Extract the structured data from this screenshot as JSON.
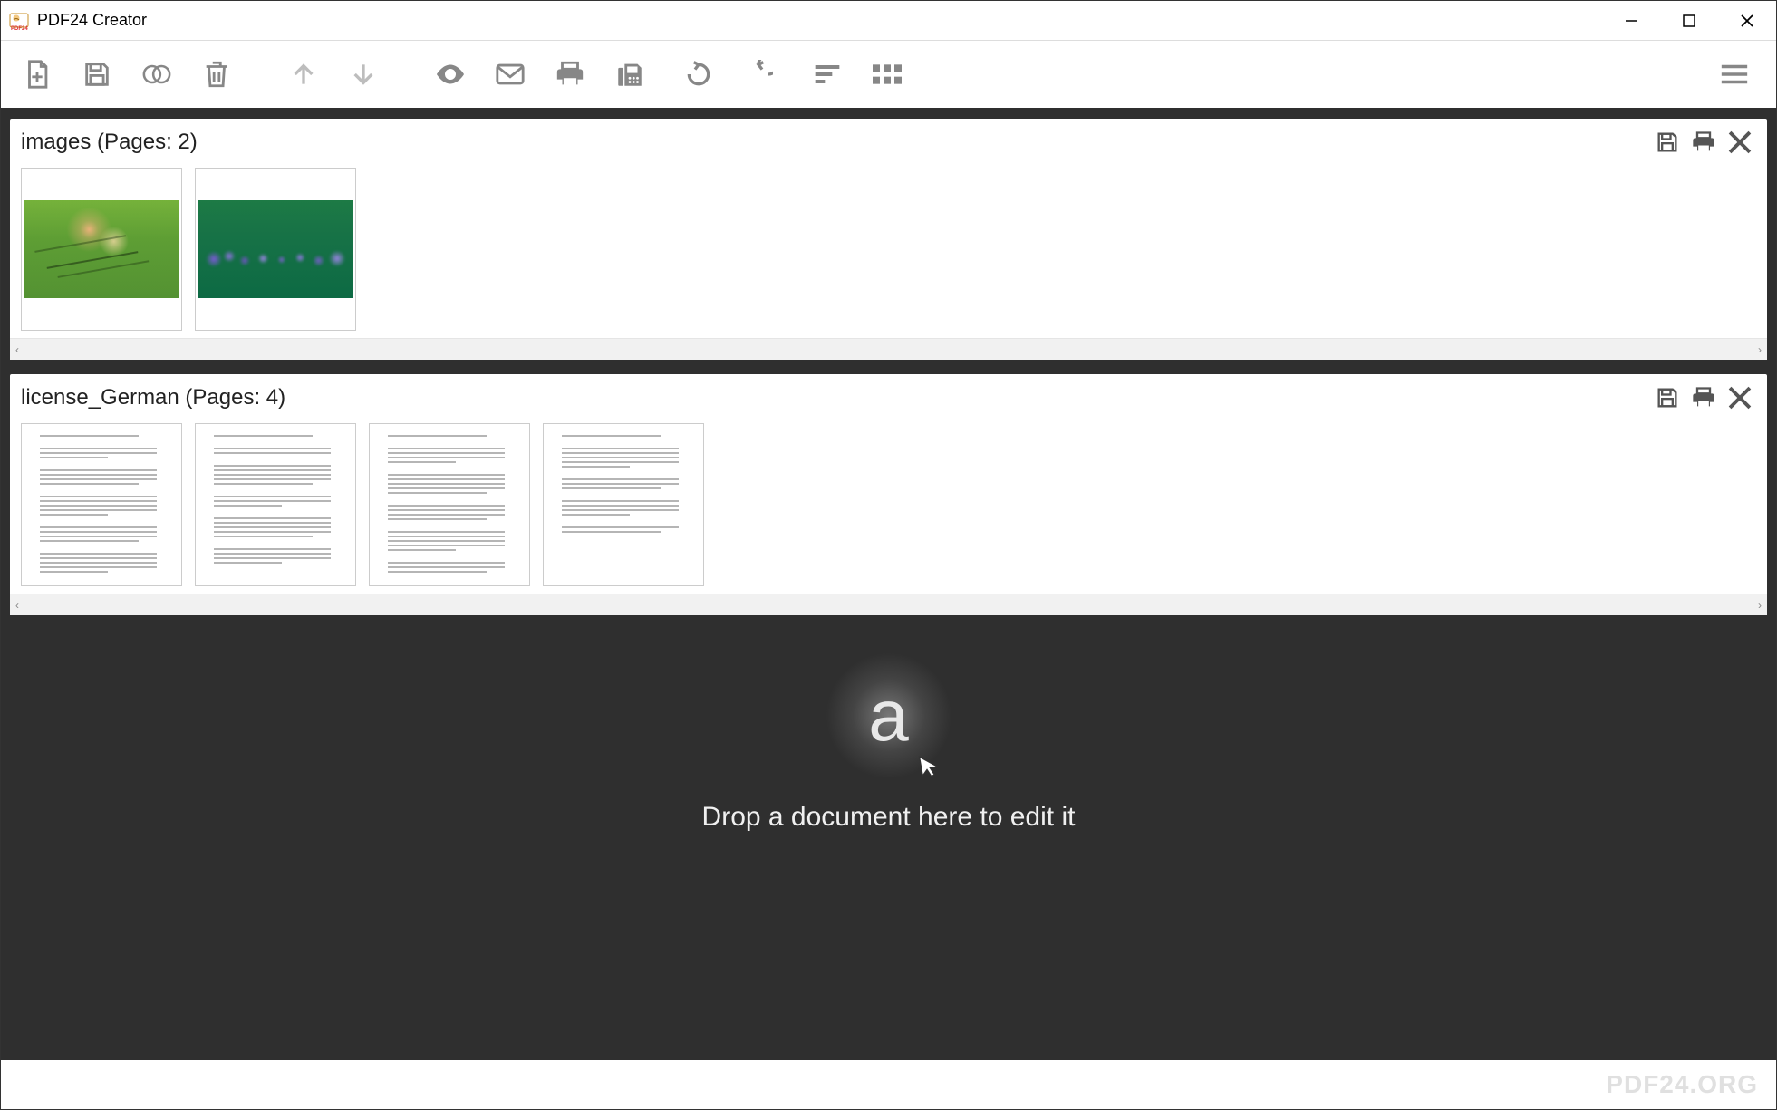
{
  "window": {
    "title": "PDF24 Creator"
  },
  "toolbar": {
    "icons": {
      "new": "new-file-icon",
      "save": "save-icon",
      "merge": "merge-icon",
      "delete": "trash-icon",
      "up": "arrow-up-icon",
      "down": "arrow-down-icon",
      "preview": "eye-icon",
      "email": "email-icon",
      "print": "printer-icon",
      "fax": "fax-icon",
      "rotate_left": "rotate-left-icon",
      "rotate_right": "rotate-right-icon",
      "sort": "sort-icon",
      "grid": "grid-icon",
      "menu": "hamburger-icon"
    }
  },
  "documents": [
    {
      "name": "images",
      "pages_label": "(Pages: 2)",
      "page_count": 2,
      "type": "image",
      "actions": {
        "save": "save-icon",
        "print": "printer-icon",
        "close": "close-icon"
      }
    },
    {
      "name": "license_German",
      "pages_label": "(Pages: 4)",
      "page_count": 4,
      "type": "text",
      "actions": {
        "save": "save-icon",
        "print": "printer-icon",
        "close": "close-icon"
      }
    }
  ],
  "dropzone": {
    "text": "Drop a document here to edit it"
  },
  "footer": {
    "brand": "PDF24.ORG"
  }
}
